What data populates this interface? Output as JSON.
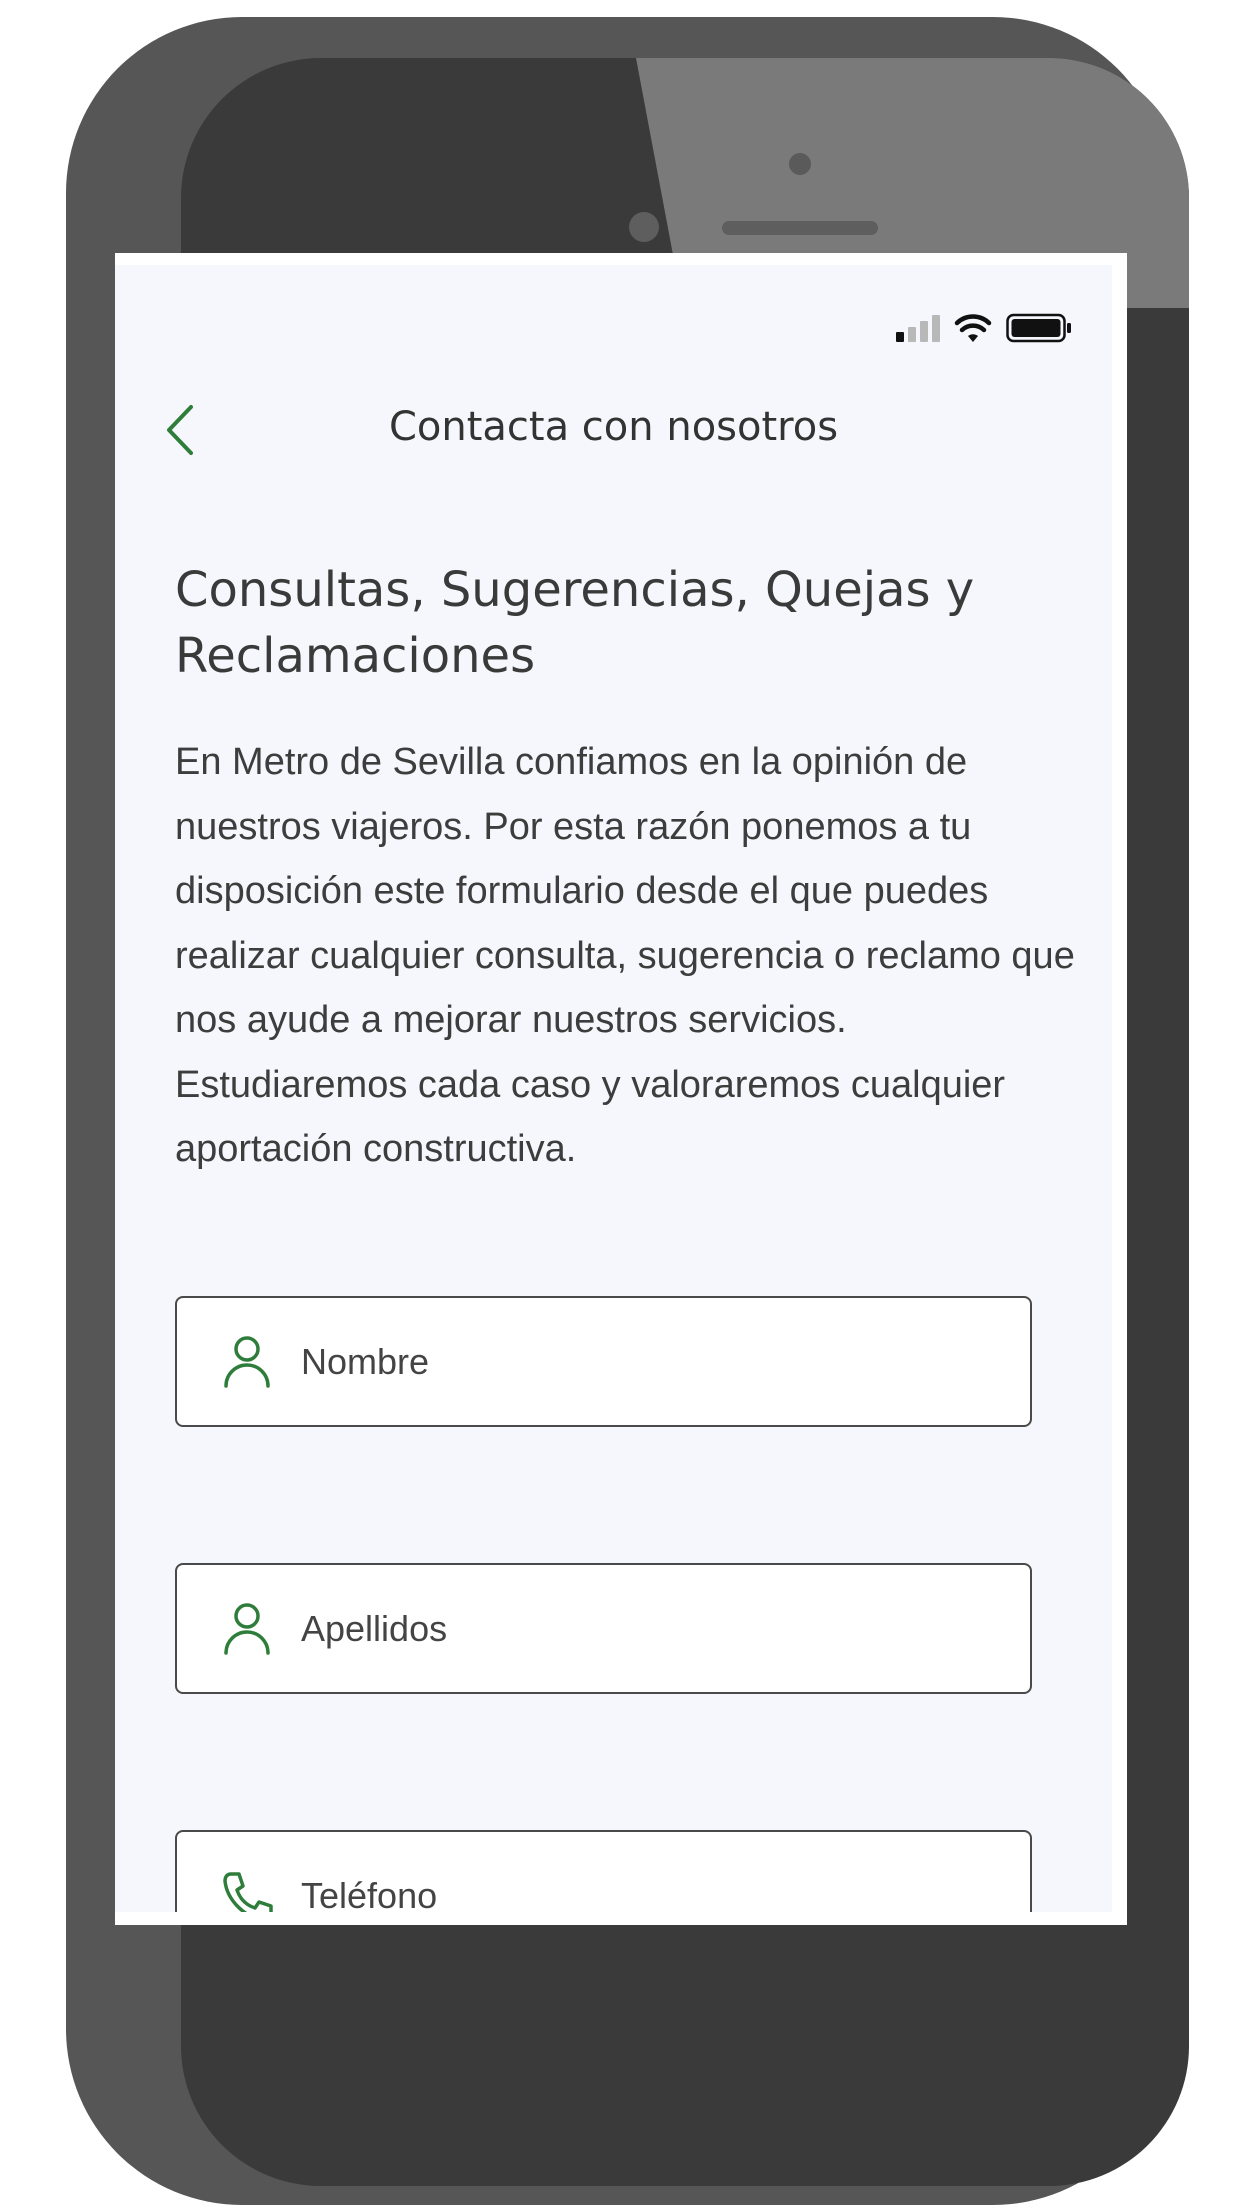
{
  "header": {
    "title": "Contacta con nosotros",
    "back_icon": "chevron-left-icon"
  },
  "status_bar": {
    "icons": [
      "cellular-signal-icon",
      "wifi-icon",
      "battery-icon"
    ]
  },
  "content": {
    "heading": "Consultas, Sugerencias, Quejas y Reclamaciones",
    "description": "En Metro de Sevilla confiamos en la opinión de nuestros viajeros. Por esta razón ponemos a tu disposición este formulario desde el que puedes realizar cualquier consulta, sugerencia o reclamo que nos ayude a mejorar nuestros servicios. Estudiaremos cada caso y valoraremos cualquier aportación constructiva."
  },
  "form": {
    "fields": [
      {
        "placeholder": "Nombre",
        "icon": "person-icon"
      },
      {
        "placeholder": "Apellidos",
        "icon": "person-icon"
      },
      {
        "placeholder": "Teléfono",
        "icon": "phone-icon"
      }
    ]
  },
  "colors": {
    "accent": "#2e7d3a",
    "background": "#f6f7fc",
    "text": "#3d3d3d",
    "frame": "#565656"
  }
}
